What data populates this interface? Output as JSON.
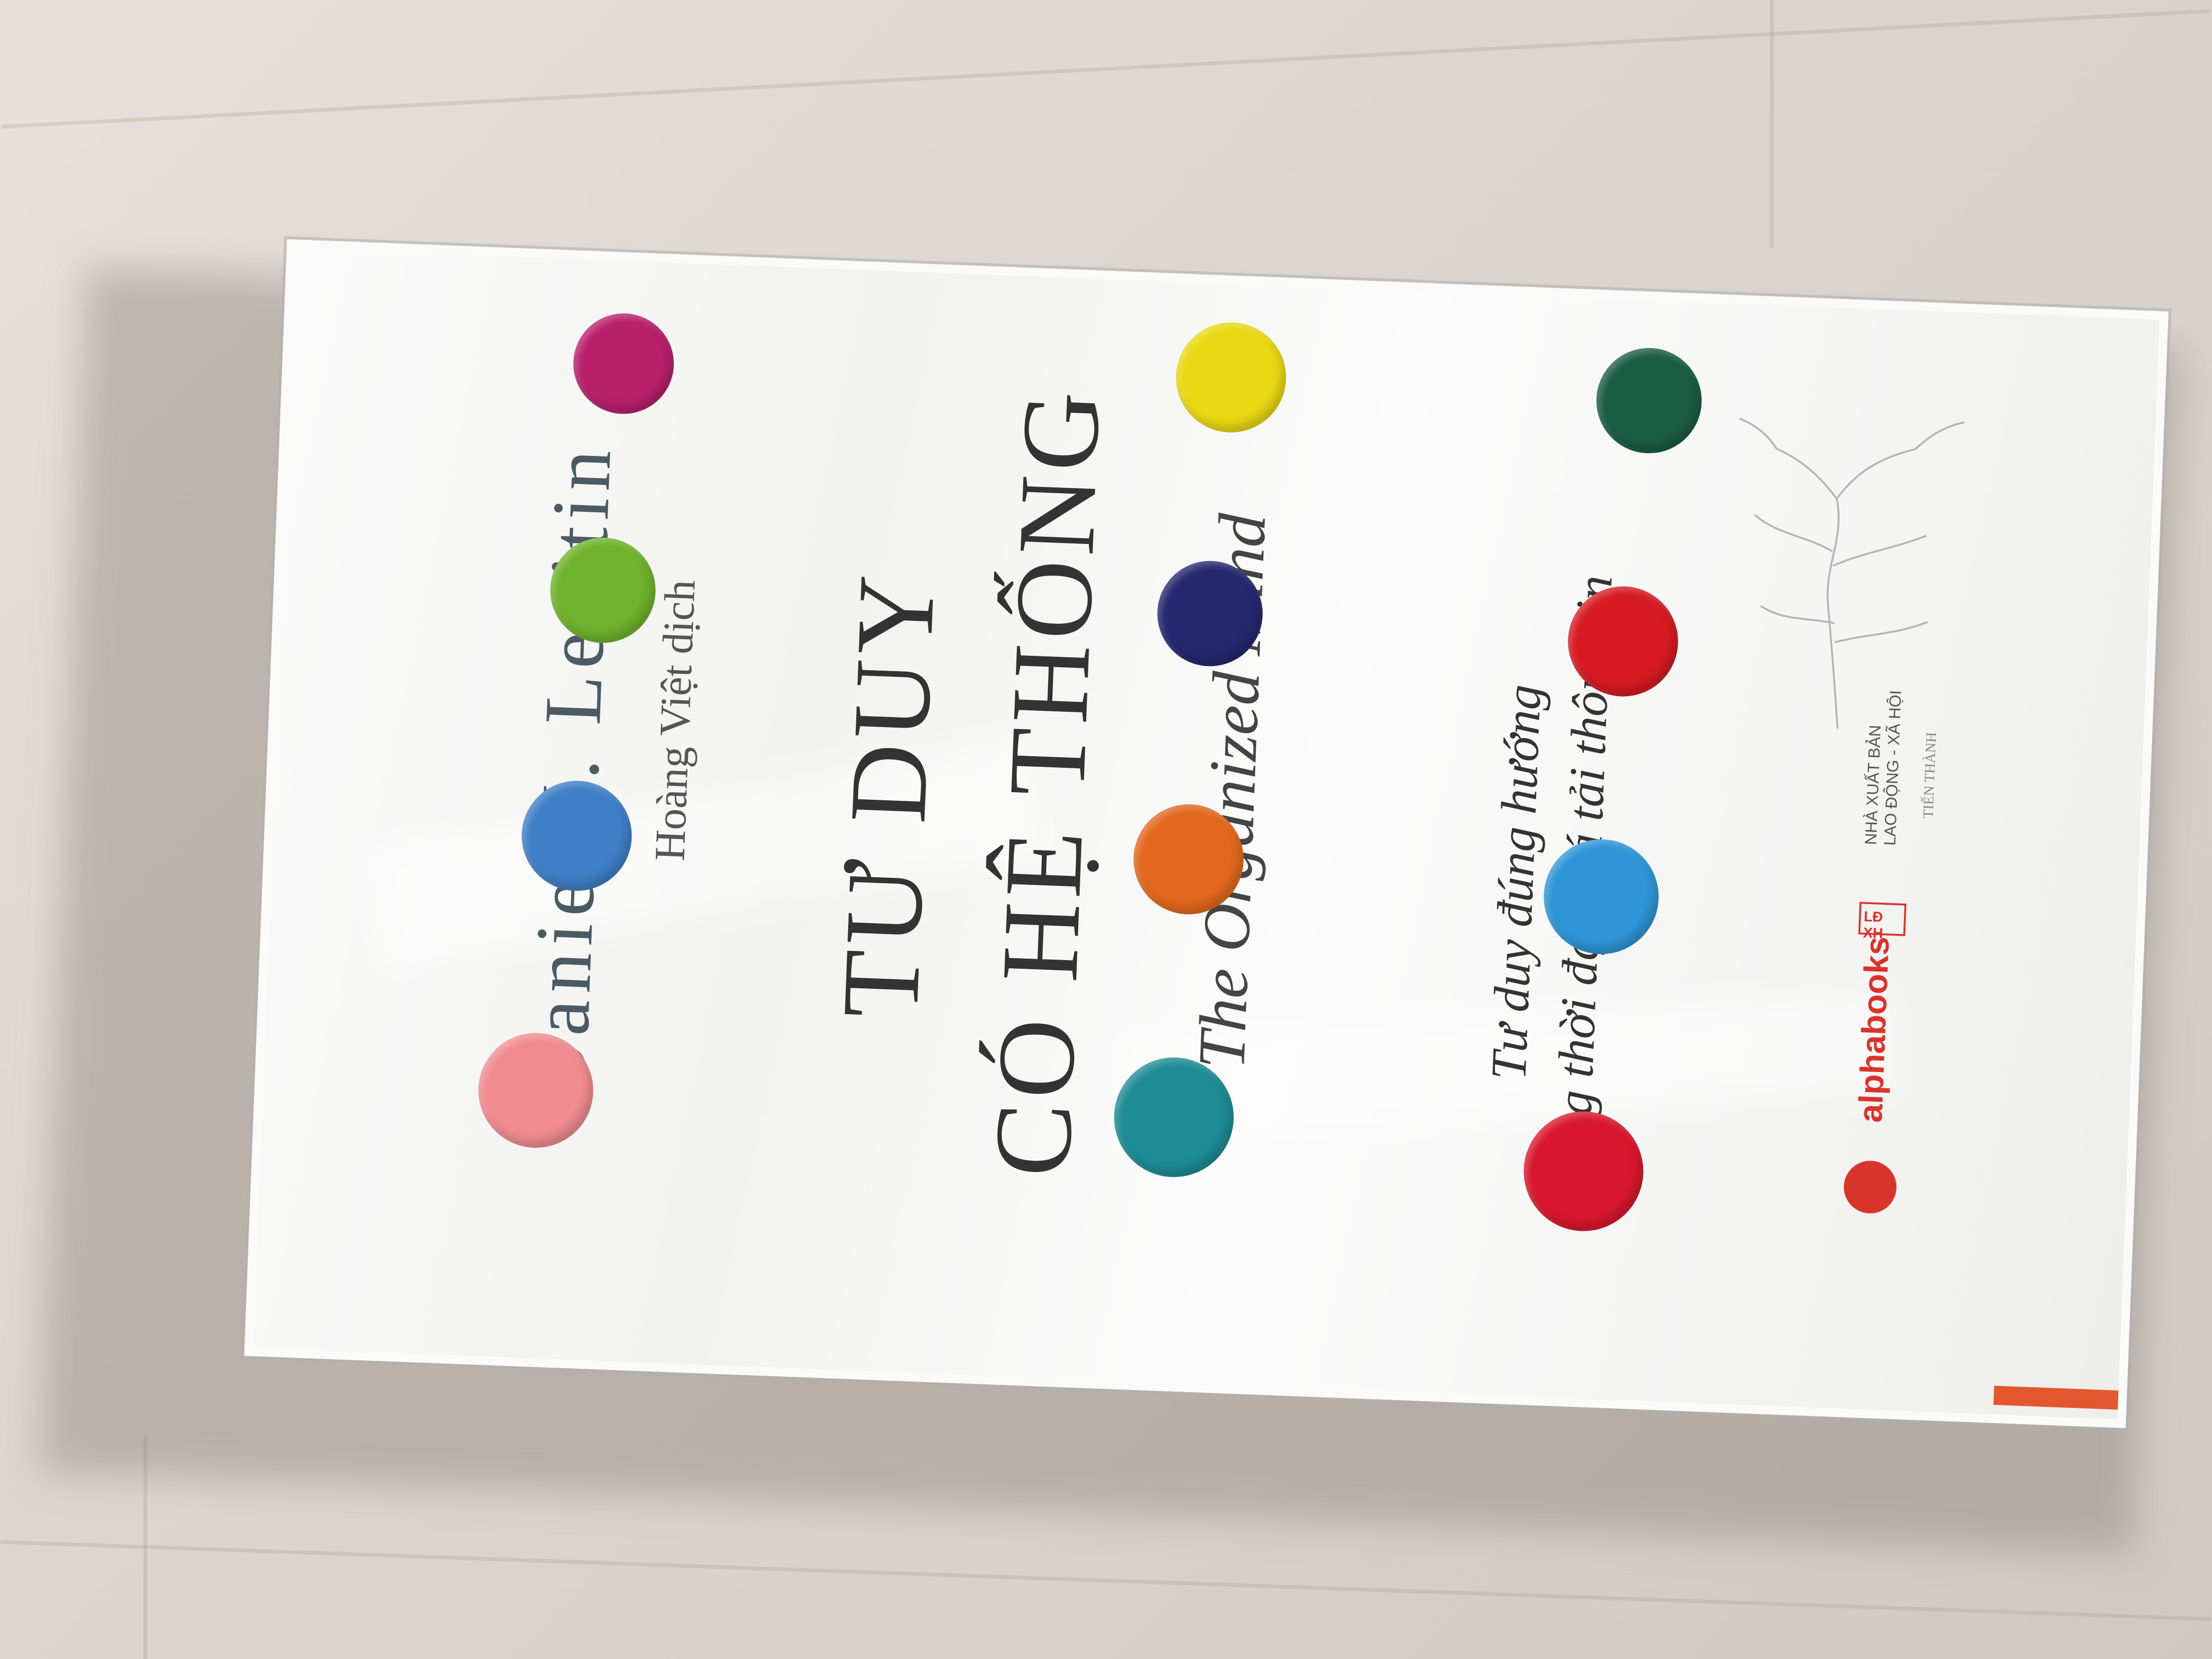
{
  "book": {
    "author": "Daniel J. Levitin",
    "translator": "Hoàng Việt dịch",
    "title_line1": "TƯ DUY",
    "title_line2": "CÓ HỆ THỐNG",
    "subtitle_en": "The Organized Mind",
    "tagline_line1": "Tư duy đúng hướng",
    "tagline_line2": "trong thời đại quá tải thông tin",
    "publisher": "alphabooks",
    "imprint_line1": "NHÀ XUẤT BẢN",
    "imprint_line2": "LAO ĐỘNG - XÃ HỘI",
    "imprint_badge": "LĐ XH",
    "signature": "TIẾN THÀNH"
  },
  "dots": [
    {
      "name": "dot-pink",
      "color": "#f08c90"
    },
    {
      "name": "dot-blue-left",
      "color": "#3f7fc6"
    },
    {
      "name": "dot-green",
      "color": "#6fb22c"
    },
    {
      "name": "dot-magenta",
      "color": "#b8206b"
    },
    {
      "name": "dot-teal",
      "color": "#1e8c94"
    },
    {
      "name": "dot-orange",
      "color": "#e2681e"
    },
    {
      "name": "dot-navy",
      "color": "#24286e"
    },
    {
      "name": "dot-yellow",
      "color": "#e9d814"
    },
    {
      "name": "dot-red-bottom",
      "color": "#d8172e"
    },
    {
      "name": "dot-blue-right",
      "color": "#2e95d6"
    },
    {
      "name": "dot-red-right",
      "color": "#d51a22"
    },
    {
      "name": "dot-darkgreen",
      "color": "#1b5c45"
    }
  ],
  "colors": {
    "accent": "#e4572e",
    "publisher_red": "#d9342b"
  }
}
